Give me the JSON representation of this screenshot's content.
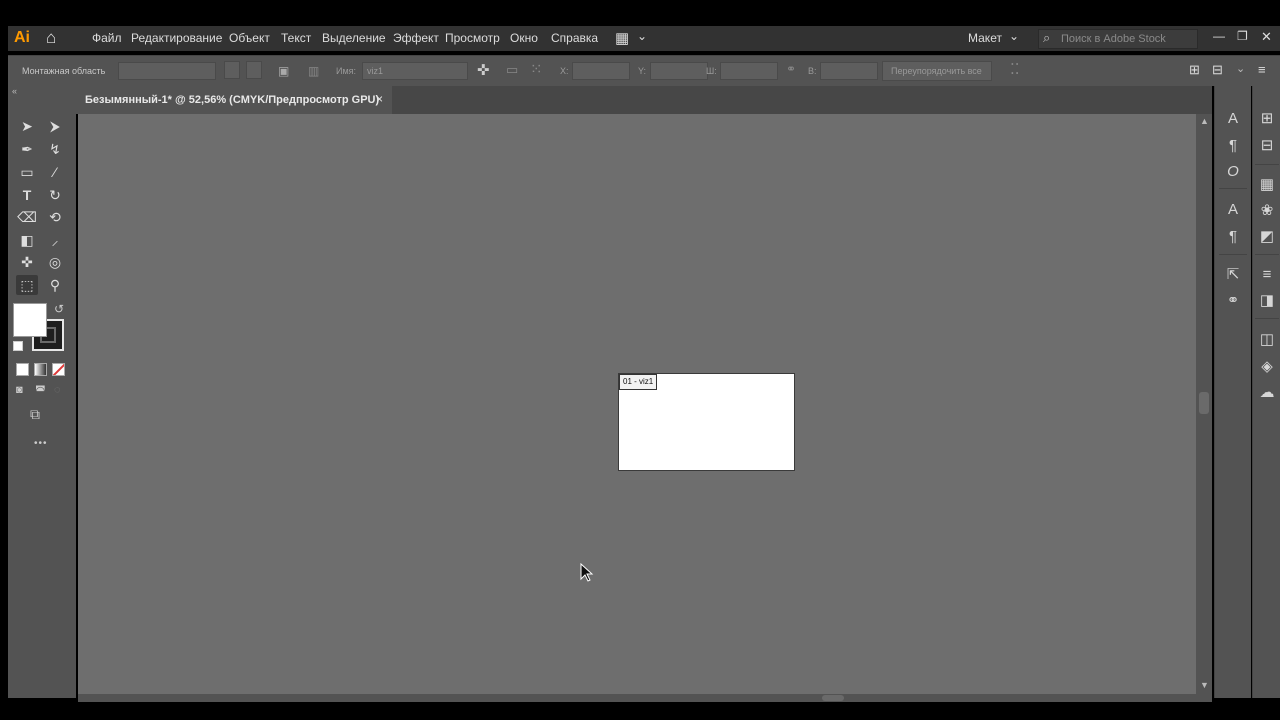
{
  "app": {
    "logo": "Ai"
  },
  "menu": {
    "items": [
      "Файл",
      "Редактирование",
      "Объект",
      "Текст",
      "Выделение",
      "Эффект",
      "Просмотр",
      "Окно",
      "Справка"
    ],
    "workspace": "Макет",
    "search_placeholder": "Поиск в Adobe Stock"
  },
  "control_bar": {
    "artboard_label": "Монтажная область",
    "name_label": "Имя:",
    "name_value": "viz1",
    "x_label": "X:",
    "y_label": "Y:",
    "w_label": "Ш:",
    "h_label": "В:",
    "rearrange_all": "Переупорядочить все"
  },
  "document": {
    "tab_title": "Безымянный-1* @ 52,56% (CMYK/Предпросмотр GPU)",
    "close_glyph": "×",
    "artboard_label": "01 - viz1"
  },
  "icons": {
    "home": "⌂",
    "arrange": "▦",
    "chevron": "⌄",
    "search": "⌕",
    "minimize": "—",
    "restore": "❐",
    "close": "✕",
    "selection": "➤",
    "direct_selection": "⮞",
    "pen": "✒",
    "curvature": "↯",
    "rectangle": "▭",
    "brush": "⁄",
    "type": "T",
    "rotate": "↻",
    "eraser": "⌫",
    "shape_builder": "⟲",
    "gradient": "◧",
    "eyedropper": "⸝",
    "puppet_warp": "✜",
    "symbol_sprayer": "◎",
    "artboard": "⬚",
    "zoom": "⚲",
    "swap": "↺",
    "more": "•••",
    "char": "A",
    "para": "¶",
    "opentype": "O",
    "char_styles": "A",
    "para_styles": "¶",
    "export": "⇱",
    "links": "⚭",
    "transform": "⊞",
    "align": "⊟",
    "swatches": "▦",
    "brushes": "❀",
    "symbols": "◩",
    "stroke": "≡",
    "gradient_panel": "◨",
    "transparency": "◫",
    "layers": "◈",
    "libraries": "☁"
  },
  "colors": {
    "fill": "#ffffff",
    "stroke": "#1e1e1e",
    "canvas": "#6e6e6e",
    "none_red": "#e03a3a"
  }
}
